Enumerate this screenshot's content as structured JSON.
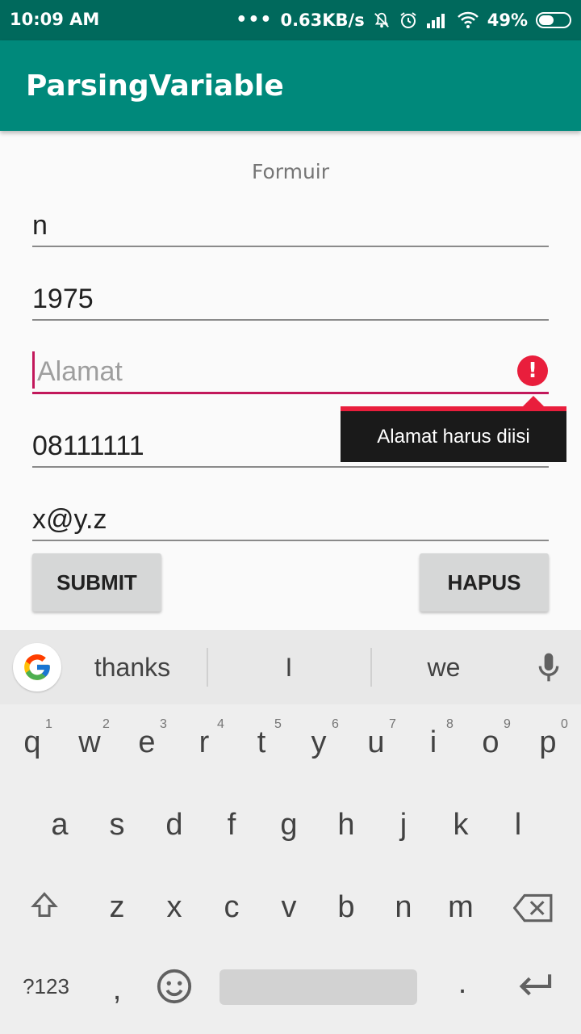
{
  "status_bar": {
    "time": "10:09 AM",
    "dots": "•••",
    "speed": "0.63KB/s",
    "battery": "49%",
    "battery_level": 0.49,
    "icons": [
      "bell-off-icon",
      "alarm-icon",
      "signal-icon",
      "wifi-icon",
      "battery-icon"
    ]
  },
  "app_bar": {
    "title": "ParsingVariable"
  },
  "form": {
    "title": "Formuir",
    "fields": [
      {
        "value": "n",
        "placeholder": ""
      },
      {
        "value": "1975",
        "placeholder": ""
      },
      {
        "value": "",
        "placeholder": "Alamat"
      },
      {
        "value": "08111111",
        "placeholder": ""
      },
      {
        "value": "x@y.z",
        "placeholder": ""
      }
    ],
    "error_message": "Alamat harus diisi",
    "error_color": "#e91e3c",
    "buttons": {
      "submit": "SUBMIT",
      "clear": "HAPUS"
    }
  },
  "keyboard": {
    "suggestions": [
      "thanks",
      "I",
      "we"
    ],
    "row1": [
      "q",
      "w",
      "e",
      "r",
      "t",
      "y",
      "u",
      "i",
      "o",
      "p"
    ],
    "row1_hints": [
      "1",
      "2",
      "3",
      "4",
      "5",
      "6",
      "7",
      "8",
      "9",
      "0"
    ],
    "row2": [
      "a",
      "s",
      "d",
      "f",
      "g",
      "h",
      "j",
      "k",
      "l"
    ],
    "row3": [
      "z",
      "x",
      "c",
      "v",
      "b",
      "n",
      "m"
    ],
    "symbols_key": "?123",
    "comma": ",",
    "period": "."
  },
  "colors": {
    "status_bar": "#00695c",
    "app_bar": "#00897b",
    "accent": "#c2185b"
  }
}
